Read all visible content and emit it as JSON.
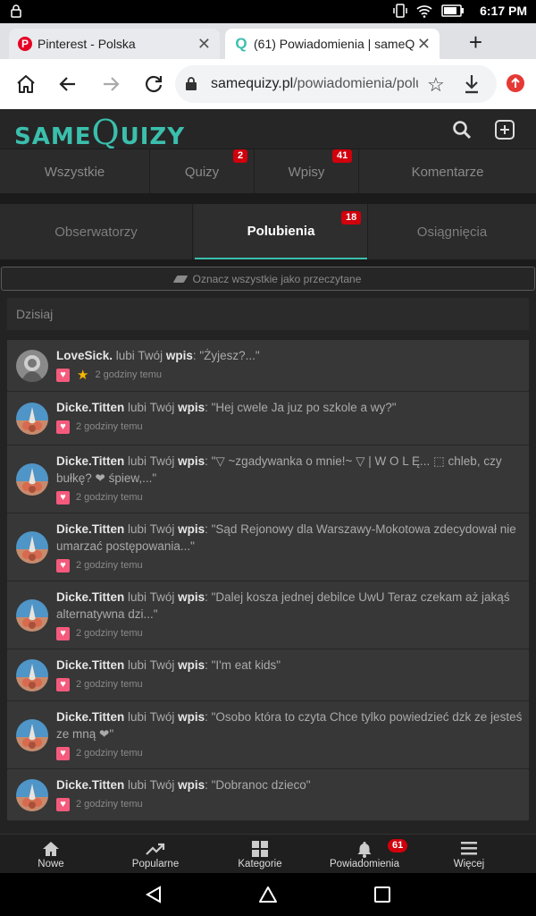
{
  "statusbar": {
    "time": "6:17 PM"
  },
  "browser": {
    "tabs": [
      {
        "title": "Pinterest - Polska",
        "close": "✕"
      },
      {
        "title": "(61) Powiadomienia | sameQuizy",
        "close": "✕"
      }
    ],
    "newtab": "+",
    "url_host": "samequizy.pl",
    "url_path": "/powiadomienia/polubienia"
  },
  "site": {
    "logo_prefix": "SAME",
    "logo_big": "Q",
    "logo_suffix": "UIZY"
  },
  "category_tabs": [
    {
      "label": "Wszystkie",
      "badge": ""
    },
    {
      "label": "Quizy",
      "badge": "2"
    },
    {
      "label": "Wpisy",
      "badge": "41"
    },
    {
      "label": "Komentarze",
      "badge": ""
    }
  ],
  "sub_tabs": [
    {
      "label": "Obserwatorzy",
      "badge": ""
    },
    {
      "label": "Polubienia",
      "badge": "18"
    },
    {
      "label": "Osiągnięcia",
      "badge": ""
    }
  ],
  "mark_all": "Oznacz wszystkie jako przeczytane",
  "section_title": "Dzisiaj",
  "notifications": [
    {
      "user": "LoveSick.",
      "action": "lubi Twój",
      "kw": "wpis",
      "text": "\"Żyjesz?...\"",
      "time": "2 godziny temu",
      "star": true,
      "avatar": "gray"
    },
    {
      "user": "Dicke.Titten",
      "action": "lubi Twój",
      "kw": "wpis",
      "text": "\"Hej cwele Ja juz po szkole a wy?\"",
      "time": "2 godziny temu",
      "star": false,
      "avatar": "blue"
    },
    {
      "user": "Dicke.Titten",
      "action": "lubi Twój",
      "kw": "wpis",
      "text": "\"▽ ~zgadywanka o mnie!~ ▽ | W O L Ę... ⬚ chleb, czy bułkę? ❤ śpiew,...\"",
      "time": "2 godziny temu",
      "star": false,
      "avatar": "blue"
    },
    {
      "user": "Dicke.Titten",
      "action": "lubi Twój",
      "kw": "wpis",
      "text": "\"Sąd Rejonowy dla Warszawy-Mokotowa zdecydował nie umarzać postępowania...\"",
      "time": "2 godziny temu",
      "star": false,
      "avatar": "blue"
    },
    {
      "user": "Dicke.Titten",
      "action": "lubi Twój",
      "kw": "wpis",
      "text": "\"Dalej kosza jednej debilce UwU Teraz czekam aż jakąś alternatywna dzi...\"",
      "time": "2 godziny temu",
      "star": false,
      "avatar": "blue"
    },
    {
      "user": "Dicke.Titten",
      "action": "lubi Twój",
      "kw": "wpis",
      "text": "\"I'm eat kids\"",
      "time": "2 godziny temu",
      "star": false,
      "avatar": "blue"
    },
    {
      "user": "Dicke.Titten",
      "action": "lubi Twój",
      "kw": "wpis",
      "text": "\"Osobo która to czyta Chce tylko powiedzieć dzk ze jesteś ze mną ❤\"",
      "time": "2 godziny temu",
      "star": false,
      "avatar": "blue"
    },
    {
      "user": "Dicke.Titten",
      "action": "lubi Twój",
      "kw": "wpis",
      "text": "\"Dobranoc dzieco\"",
      "time": "2 godziny temu",
      "star": false,
      "avatar": "blue"
    }
  ],
  "bottom_nav": [
    {
      "label": "Nowe",
      "icon": "home-icon"
    },
    {
      "label": "Popularne",
      "icon": "trending-icon"
    },
    {
      "label": "Kategorie",
      "icon": "categories-icon"
    },
    {
      "label": "Powiadomienia",
      "icon": "bell-icon",
      "badge": "61"
    },
    {
      "label": "Więcej",
      "icon": "menu-icon"
    }
  ],
  "colors": {
    "accent": "#3bbfad",
    "badge": "#d0000c",
    "heart": "#f45a7c"
  }
}
